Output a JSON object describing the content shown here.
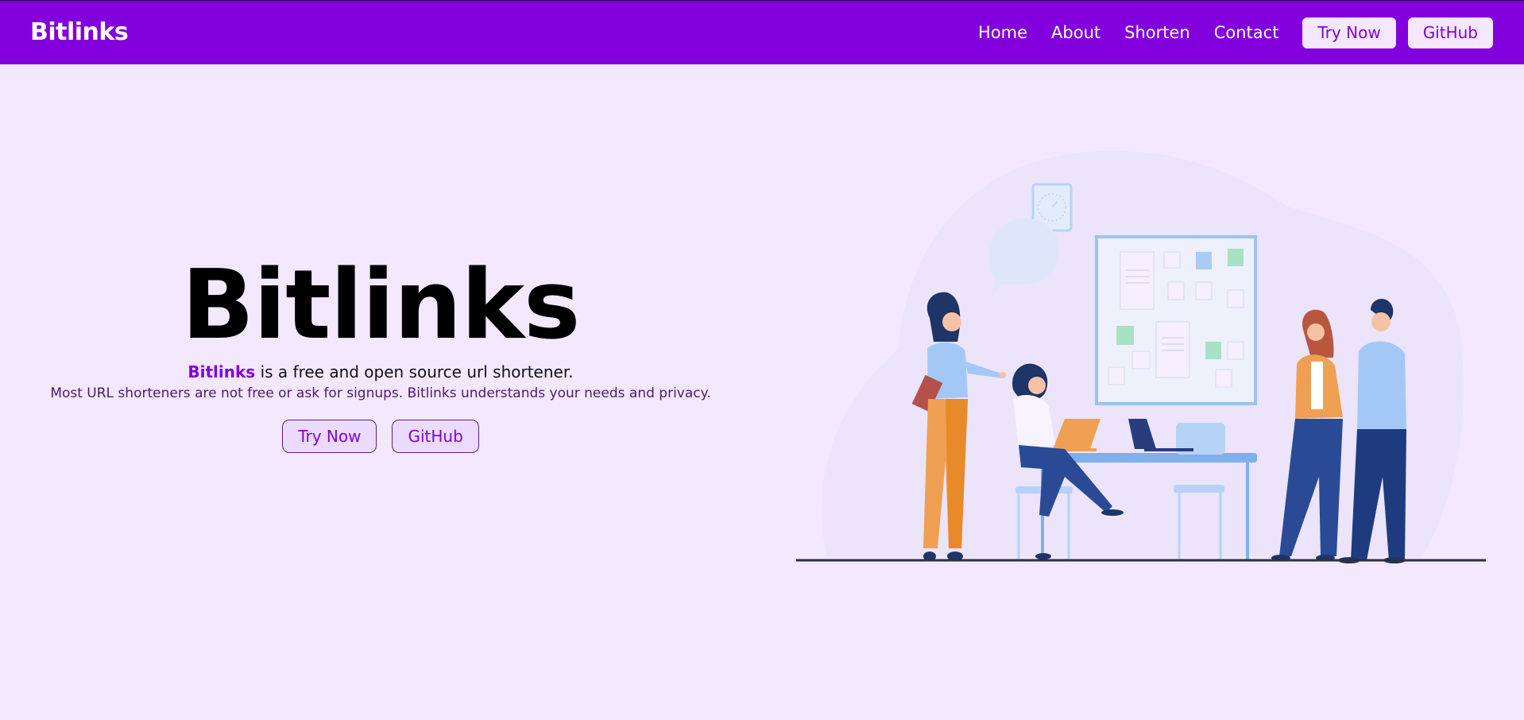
{
  "navbar": {
    "brand": "Bitlinks",
    "links": [
      "Home",
      "About",
      "Shorten",
      "Contact"
    ],
    "try_now": "Try Now",
    "github": "GitHub"
  },
  "hero": {
    "title": "Bitlinks",
    "tagline_accent": "Bitlinks",
    "tagline_rest": " is a free and open source url shortener.",
    "subtitle": "Most URL shorteners are not free or ask for signups. Bitlinks understands your needs and privacy.",
    "try_now": "Try Now",
    "github": "GitHub"
  },
  "colors": {
    "primary": "#8200db",
    "background": "#f3e8ff",
    "button_bg": "#f3e8ff"
  },
  "illustration": {
    "icon": "team-working-illustration"
  }
}
